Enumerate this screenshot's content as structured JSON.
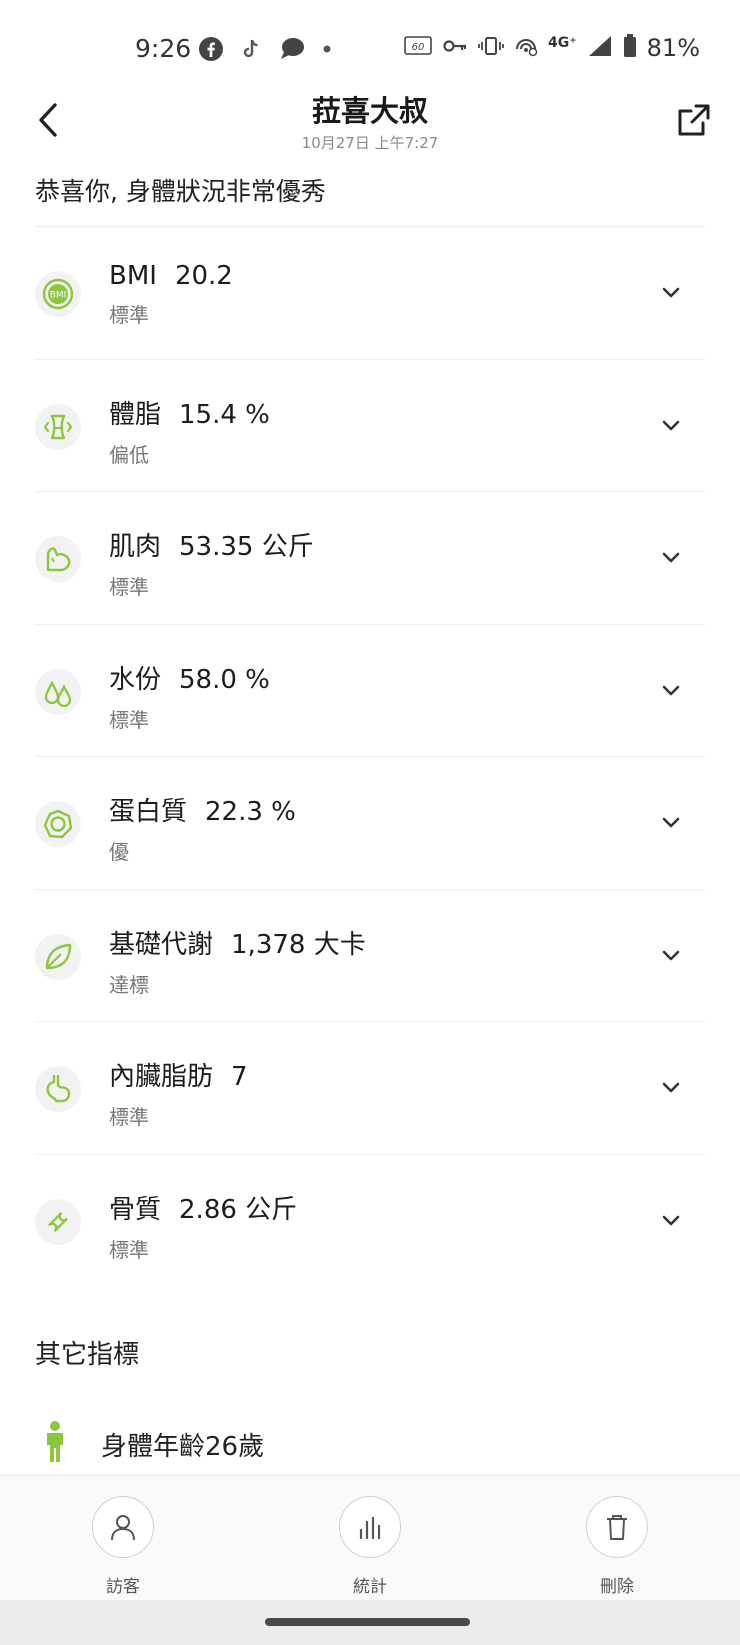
{
  "status_bar": {
    "time": "9:26",
    "network": "4G⁺",
    "battery": "81%",
    "refresh_badge": "60"
  },
  "header": {
    "title": "菈喜大叔",
    "subtitle": "10月27日 上午7:27"
  },
  "summary": "恭喜你, 身體狀況非常優秀",
  "metrics": [
    {
      "icon": "bmi-icon",
      "name": "BMI",
      "value": "20.2",
      "status": "標準"
    },
    {
      "icon": "body-fat-icon",
      "name": "體脂",
      "value": "15.4 %",
      "status": "偏低"
    },
    {
      "icon": "muscle-icon",
      "name": "肌肉",
      "value": "53.35 公斤",
      "status": "標準"
    },
    {
      "icon": "water-drops-icon",
      "name": "水份",
      "value": "58.0 %",
      "status": "標準"
    },
    {
      "icon": "protein-icon",
      "name": "蛋白質",
      "value": "22.3 %",
      "status": "優"
    },
    {
      "icon": "leaf-icon",
      "name": "基礎代謝",
      "value": "1,378 大卡",
      "status": "達標"
    },
    {
      "icon": "visceral-fat-icon",
      "name": "內臟脂肪",
      "value": "7",
      "status": "標準"
    },
    {
      "icon": "bone-icon",
      "name": "骨質",
      "value": "2.86 公斤",
      "status": "標準"
    }
  ],
  "other": {
    "title": "其它指標",
    "body_age": "身體年齡26歲"
  },
  "actions": {
    "visitor": "訪客",
    "stats": "統計",
    "delete": "刪除"
  },
  "colors": {
    "accent": "#8cc63f",
    "icon_bg": "#f2f2f2"
  }
}
